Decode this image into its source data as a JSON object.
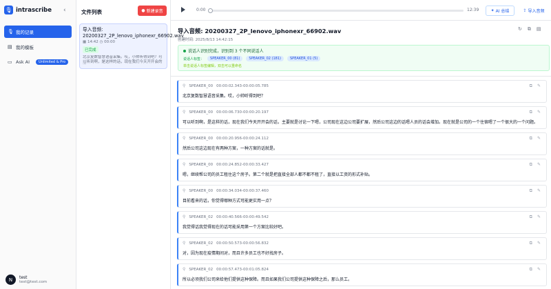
{
  "sidebar": {
    "brand": "intrascribe",
    "collapse_icon": "‹",
    "items": [
      {
        "label": "我的记录",
        "icon": "mic-icon",
        "active": true
      },
      {
        "label": "我的模板",
        "icon": "template-icon",
        "active": false
      },
      {
        "label": "Ask AI",
        "icon": "chat-icon",
        "active": false,
        "badge": "Unlimited & Pro"
      }
    ],
    "user": {
      "initial": "N",
      "name": "test",
      "email": "test@test.com"
    }
  },
  "filelist": {
    "title": "文件列表",
    "new_button": "新建录音",
    "file": {
      "name": "导入音频: 20200327_2P_lenovo_iphonexr_66902.wav",
      "time": "14:42",
      "duration": "00:00",
      "status": "已完成",
      "preview": "北京复数智慧语音采集。哎，小帅听得到吧？可以听到啊，是这样的话，现在我们今天开开会的话，"
    }
  },
  "player": {
    "time_start": "0:00",
    "time_end": "12:39",
    "progress": 0.0,
    "ai_button": "AI 总结",
    "import_button": "导入音频"
  },
  "detail": {
    "title": "导入音频: 20200327_2P_lenovo_iphonexr_66902.wav",
    "date": "创建时间: 2025/8/13 14:42:15",
    "notice": {
      "line1": "说话人识别完成，识别到 3 个不同说话人",
      "speaker_label": "说话人标签：",
      "speakers": [
        "SPEAKER_00 (81)",
        "SPEAKER_02 (181)",
        "SPEAKER_01 (5)"
      ],
      "hint": "单击说话人标签编辑，双击可以重命名"
    }
  },
  "segments": [
    {
      "speaker": "SPEAKER_00",
      "range": "00:00:02.343-00:00:05.785",
      "text": "北京复数智慧语音采集。哎，小帅听得到吧？"
    },
    {
      "speaker": "SPEAKER_00",
      "range": "00:00:06.730-00:00:20.197",
      "text": "可以听到啊，是这样的话，现在我们今天开开会的话，主要就是讨论一下嗯，公司现在这边公司要扩展，然后公司这边的话嗯人员的话会增加。现在就是公司的一个住宿嗯了一个很大的一个问题。"
    },
    {
      "speaker": "SPEAKER_00",
      "range": "00:00:20.956-00:00:24.112",
      "text": "然后公司这边现在有两种方案，一种方案的话就是。"
    },
    {
      "speaker": "SPEAKER_00",
      "range": "00:00:24.852-00:00:33.427",
      "text": "嗯，继续帮公司的员工租住这个房子。第二个就是把直接全部人都不都不租了，直接以工资的形式补贴。"
    },
    {
      "speaker": "SPEAKER_00",
      "range": "00:00:34.034-00:00:37.460",
      "text": "目前看来的话，你觉得哪种方式可能更实用一点？"
    },
    {
      "speaker": "SPEAKER_02",
      "range": "00:00:40.566-00:00:49.542",
      "text": "我觉得话我觉得现在的话可能采用第一个方案比较好吧。"
    },
    {
      "speaker": "SPEAKER_02",
      "range": "00:00:50.573-00:00:56.832",
      "text": "对，因为现在疫情期间对，而且许多员工也不好找房子。"
    },
    {
      "speaker": "SPEAKER_02",
      "range": "00:00:57.473-00:01:05.824",
      "text": "所以必须我们公司来给他们提供这种保障。而且如果我们公司提供这种保障之后，那么员工。"
    }
  ]
}
